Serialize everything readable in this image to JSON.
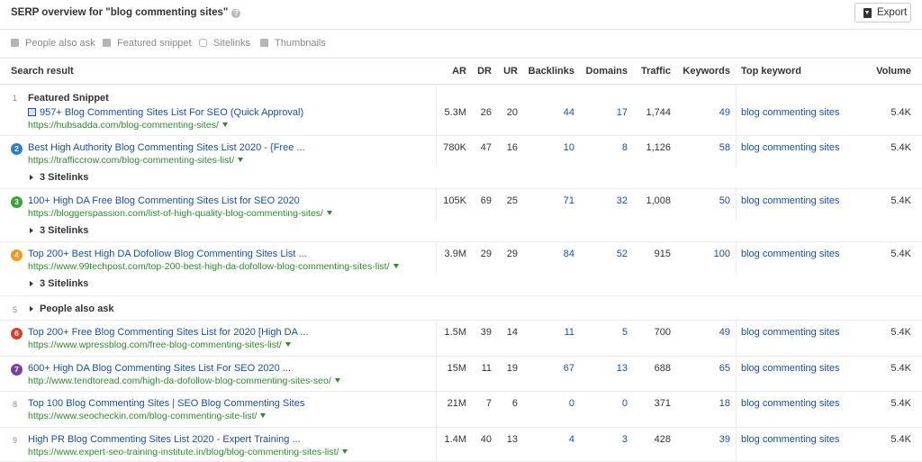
{
  "header": {
    "title": "SERP overview for \"blog commenting sites\"",
    "help_icon": "?",
    "export_label": "Export"
  },
  "features": [
    {
      "icon": "people-also-ask-icon",
      "label": "People also ask"
    },
    {
      "icon": "featured-snippet-icon",
      "label": "Featured snippet"
    },
    {
      "icon": "sitelinks-icon",
      "label": "Sitelinks"
    },
    {
      "icon": "thumbnails-icon",
      "label": "Thumbnails"
    }
  ],
  "columns": {
    "result": "Search result",
    "ar": "AR",
    "dr": "DR",
    "ur": "UR",
    "backlinks": "Backlinks",
    "domains": "Domains",
    "traffic": "Traffic",
    "keywords": "Keywords",
    "top_keyword": "Top keyword",
    "volume": "Volume"
  },
  "rows": [
    {
      "pos": "1",
      "label": "Featured Snippet",
      "title": "957+ Blog Commenting Sites List For SEO (Quick Approval)",
      "url": "https://hubsadda.com/blog-commenting-sites/",
      "ar": "5.3M",
      "dr": "26",
      "ur": "20",
      "backlinks": "44",
      "domains": "17",
      "traffic": "1,744",
      "keywords": "49",
      "top_keyword": "blog commenting sites",
      "volume": "5.4K"
    },
    {
      "pos": "2",
      "color": "#2f7fc4",
      "title": "Best High Authority Blog Commenting Sites List 2020 - {Free ...",
      "url": "https://trafficcrow.com/blog-commenting-sites-list/",
      "sitelinks": "3 Sitelinks",
      "ar": "780K",
      "dr": "47",
      "ur": "16",
      "backlinks": "10",
      "domains": "8",
      "traffic": "1,126",
      "keywords": "58",
      "top_keyword": "blog commenting sites",
      "volume": "5.4K"
    },
    {
      "pos": "3",
      "color": "#3aa335",
      "title": "100+ High DA Free Blog Commenting Sites List for SEO 2020",
      "url": "https://bloggerspassion.com/list-of-high-quality-blog-commenting-sites/",
      "sitelinks": "3 Sitelinks",
      "ar": "105K",
      "dr": "69",
      "ur": "25",
      "backlinks": "71",
      "domains": "32",
      "traffic": "1,008",
      "keywords": "50",
      "top_keyword": "blog commenting sites",
      "volume": "5.4K"
    },
    {
      "pos": "4",
      "color": "#f39a1e",
      "title": "Top 200+ Best High DA Dofollow Blog Commenting Sites List ...",
      "url": "https://www.99techpost.com/top-200-best-high-da-dofollow-blog-commenting-sites-list/",
      "sitelinks": "3 Sitelinks",
      "ar": "3.9M",
      "dr": "29",
      "ur": "29",
      "backlinks": "84",
      "domains": "52",
      "traffic": "915",
      "keywords": "100",
      "top_keyword": "blog commenting sites",
      "volume": "5.4K"
    },
    {
      "pos": "5",
      "paa": "People also ask"
    },
    {
      "pos": "6",
      "color": "#d9402b",
      "title": "Top 200+ Free Blog Commenting Sites List for 2020 [High DA ...",
      "url": "https://www.wpressblog.com/free-blog-commenting-sites-list/",
      "ar": "1.5M",
      "dr": "39",
      "ur": "14",
      "backlinks": "11",
      "domains": "5",
      "traffic": "700",
      "keywords": "49",
      "top_keyword": "blog commenting sites",
      "volume": "5.4K"
    },
    {
      "pos": "7",
      "color": "#7b3fa6",
      "title": "600+ High DA Blog Commenting Sites List For SEO 2020 ...",
      "url": "http://www.tendtoread.com/high-da-dofollow-blog-commenting-sites-seo/",
      "ar": "15M",
      "dr": "11",
      "ur": "19",
      "backlinks": "67",
      "domains": "13",
      "traffic": "688",
      "keywords": "65",
      "top_keyword": "blog commenting sites",
      "volume": "5.4K"
    },
    {
      "pos": "8",
      "title": "Top 100 Blog Commenting Sites | SEO Blog Commenting Sites",
      "url": "https://www.seocheckin.com/blog-commenting-site-list/",
      "ar": "21M",
      "dr": "7",
      "ur": "6",
      "backlinks": "0",
      "domains": "0",
      "traffic": "371",
      "keywords": "18",
      "top_keyword": "blog commenting sites",
      "volume": "5.4K"
    },
    {
      "pos": "9",
      "title": "High PR Blog Commenting Sites List 2020 - Expert Training ...",
      "url": "https://www.expert-seo-training-institute.in/blog/blog-commenting-sites-list/",
      "ar": "1.4M",
      "dr": "40",
      "ur": "13",
      "backlinks": "4",
      "domains": "3",
      "traffic": "428",
      "keywords": "39",
      "top_keyword": "blog commenting sites",
      "volume": "5.4K"
    }
  ]
}
